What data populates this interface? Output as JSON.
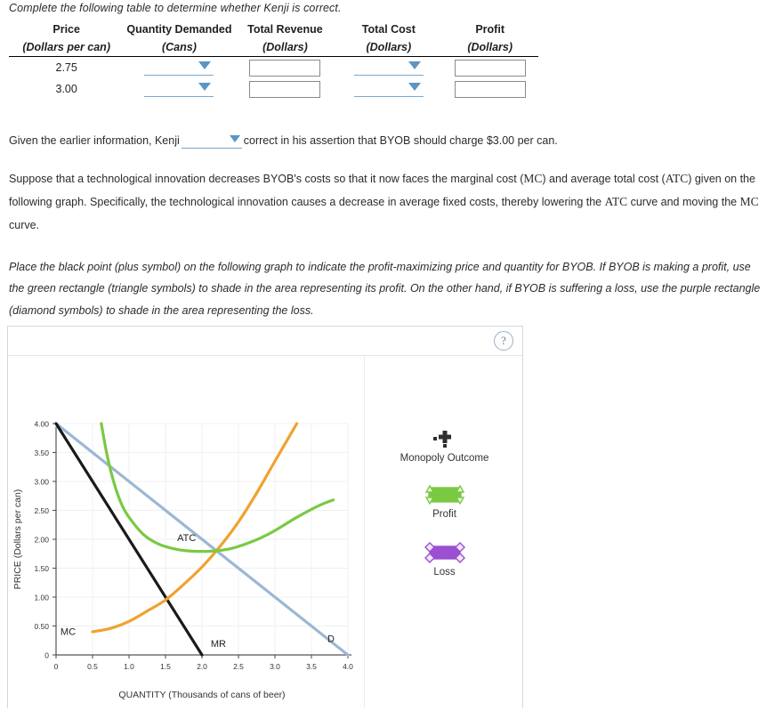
{
  "intro": {
    "text": "Complete the following table to determine whether Kenji is correct."
  },
  "table": {
    "columns": [
      {
        "title": "Price",
        "unit": "(Dollars per can)",
        "type": "text"
      },
      {
        "title": "Quantity Demanded",
        "unit": "(Cans)",
        "type": "dropdown"
      },
      {
        "title": "Total Revenue",
        "unit": "(Dollars)",
        "type": "textbox"
      },
      {
        "title": "Total Cost",
        "unit": "(Dollars)",
        "type": "dropdown"
      },
      {
        "title": "Profit",
        "unit": "(Dollars)",
        "type": "textbox"
      }
    ],
    "rows": [
      {
        "price": "2.75",
        "quantity_demanded": "",
        "total_revenue": "",
        "total_cost": "",
        "profit": ""
      },
      {
        "price": "3.00",
        "quantity_demanded": "",
        "total_revenue": "",
        "total_cost": "",
        "profit": ""
      }
    ]
  },
  "assertion": {
    "before": "Given the earlier information, Kenji",
    "dropdown_value": "",
    "after": "correct in his assertion that BYOB should charge $3.00 per can."
  },
  "paragraph_tech": {
    "p1a": "Suppose that a technological innovation decreases BYOB's costs so that it now faces the marginal cost (",
    "mc1": "MC",
    "p1b": ") and average total cost (",
    "atc1": "ATC",
    "p1c": ") given on the following graph. Specifically, the technological innovation causes a decrease in average fixed costs, thereby lowering the ",
    "atc2": "ATC",
    "p1d": " curve and moving the ",
    "mc2": "MC",
    "p1e": " curve."
  },
  "paragraph_instructions": {
    "text": "Place the black point (plus symbol) on the following graph to indicate the profit-maximizing price and quantity for BYOB. If BYOB is making a profit, use the green rectangle (triangle symbols) to shade in the area representing its profit. On the other hand, if BYOB is suffering a loss, use the purple rectangle (diamond symbols) to shade in the area representing the loss."
  },
  "panel": {
    "help_icon": "?"
  },
  "legend": {
    "items": [
      {
        "label": "Monopoly Outcome",
        "symbol": "plus",
        "color": "#2e2e2e"
      },
      {
        "label": "Profit",
        "symbol": "triangle-rectangle",
        "color": "#7ac943"
      },
      {
        "label": "Loss",
        "symbol": "diamond-rectangle",
        "color": "#9b4fd1"
      }
    ]
  },
  "chart_data": {
    "type": "line",
    "title": "",
    "xlabel": "QUANTITY (Thousands of cans of beer)",
    "ylabel": "PRICE (Dollars per can)",
    "xlim": [
      0,
      4.0
    ],
    "ylim": [
      0,
      4.0
    ],
    "xticks": [
      "0",
      "0.5",
      "1.0",
      "1.5",
      "2.0",
      "2.5",
      "3.0",
      "3.5",
      "4.0"
    ],
    "yticks": [
      "0",
      "0.50",
      "1.00",
      "1.50",
      "2.00",
      "2.50",
      "3.00",
      "3.50",
      "4.00"
    ],
    "grid": true,
    "legend_position": "inline-curve-labels",
    "series": [
      {
        "name": "D",
        "label": "D",
        "color": "#9bb7d4",
        "kind": "line",
        "points": [
          [
            0,
            4.0
          ],
          [
            4.0,
            0
          ]
        ]
      },
      {
        "name": "MR",
        "label": "MR",
        "color": "#1a1a1a",
        "kind": "line",
        "points": [
          [
            0,
            4.0
          ],
          [
            2.0,
            0
          ]
        ]
      },
      {
        "name": "MC",
        "label": "MC",
        "color": "#f0a22e",
        "kind": "curve",
        "points": [
          [
            0.5,
            0.4
          ],
          [
            0.75,
            0.46
          ],
          [
            1.0,
            0.58
          ],
          [
            1.25,
            0.76
          ],
          [
            1.5,
            0.95
          ],
          [
            1.75,
            1.22
          ],
          [
            2.0,
            1.52
          ],
          [
            2.25,
            1.88
          ],
          [
            2.5,
            2.3
          ],
          [
            2.75,
            2.8
          ],
          [
            3.0,
            3.35
          ],
          [
            3.3,
            4.0
          ]
        ]
      },
      {
        "name": "ATC",
        "label": "ATC",
        "color": "#7ac943",
        "kind": "curve",
        "points": [
          [
            0.62,
            4.0
          ],
          [
            0.7,
            3.45
          ],
          [
            0.8,
            2.95
          ],
          [
            0.9,
            2.6
          ],
          [
            1.0,
            2.38
          ],
          [
            1.2,
            2.08
          ],
          [
            1.4,
            1.92
          ],
          [
            1.6,
            1.84
          ],
          [
            1.8,
            1.8
          ],
          [
            2.0,
            1.79
          ],
          [
            2.2,
            1.8
          ],
          [
            2.4,
            1.84
          ],
          [
            2.6,
            1.92
          ],
          [
            2.8,
            2.02
          ],
          [
            3.0,
            2.15
          ],
          [
            3.3,
            2.38
          ],
          [
            3.6,
            2.58
          ],
          [
            3.8,
            2.68
          ]
        ]
      }
    ],
    "annotations": [
      {
        "text": "ATC",
        "x": 1.66,
        "y": 1.97
      },
      {
        "text": "MC",
        "x": 0.06,
        "y": 0.35
      },
      {
        "text": "MR",
        "x": 2.12,
        "y": 0.14
      },
      {
        "text": "D",
        "x": 3.72,
        "y": 0.22
      }
    ]
  }
}
